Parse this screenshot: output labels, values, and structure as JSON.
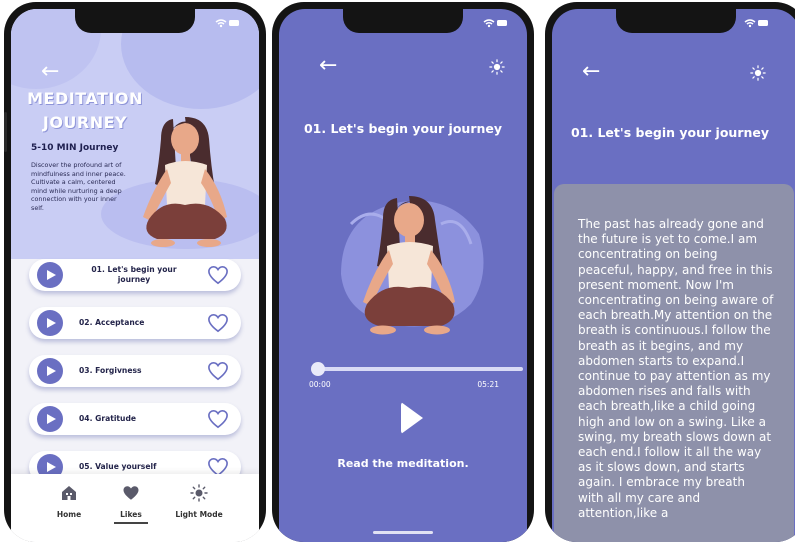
{
  "screen1": {
    "hero_title": "MEDITATION JOURNEY",
    "subtitle": "5-10 MIN Journey",
    "description": "Discover the profound art of mindfulness and inner peace. Cultivate a calm, centered mind while nurturing a deep connection with your inner self.",
    "tracks": [
      {
        "label": "01. Let's begin your journey"
      },
      {
        "label": "02. Acceptance"
      },
      {
        "label": "03. Forgivness"
      },
      {
        "label": "04. Gratitude"
      },
      {
        "label": "05. Value yourself"
      }
    ],
    "tabs": [
      {
        "label": "Home",
        "icon": "home-icon"
      },
      {
        "label": "Likes",
        "icon": "heart-icon"
      },
      {
        "label": "Light Mode",
        "icon": "sun-icon"
      }
    ]
  },
  "screen2": {
    "title": "01. Let's begin your journey",
    "time_current": "00:00",
    "time_total": "05:21",
    "progress": 0,
    "read_label": "Read the meditation."
  },
  "screen3": {
    "title": "01. Let's begin your journey",
    "meditation_text": "The past has already gone and the future is yet to come.I am concentrating on being peaceful, happy, and free in this present moment. Now I'm concentrating on being aware of each breath.My attention on the breath is continuous.I follow the breath as it begins, and my abdomen starts to expand.I continue to pay attention as my abdomen rises and falls with each breath,like a child going high and low on a swing. Like a swing, my breath slows down at each end.I follow it all the way as it slows down, and starts again. I embrace my breath with all my care and attention,like a"
  },
  "colors": {
    "primary": "#6a6fc2",
    "hero_bg": "#c9cdf4",
    "overlay": "#9698a5"
  }
}
